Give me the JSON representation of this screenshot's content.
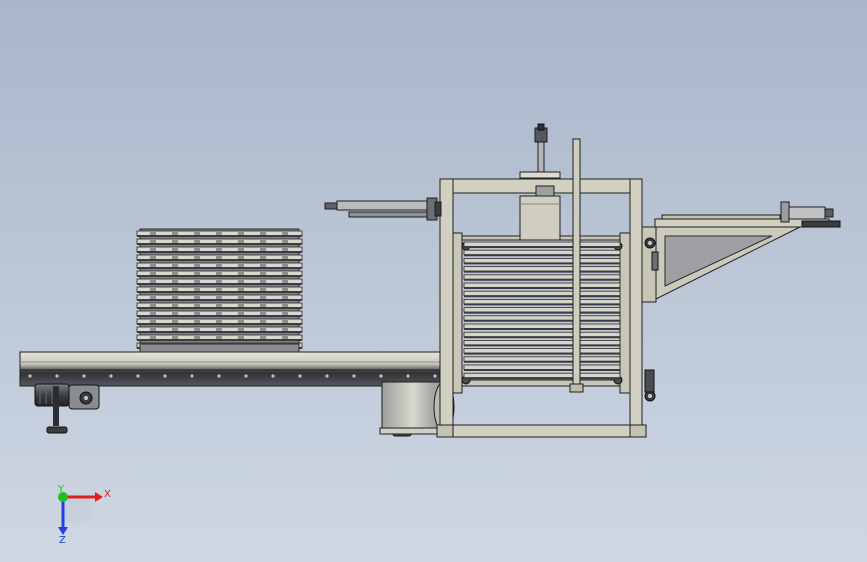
{
  "viewport": {
    "background_top": "#a9b6c9",
    "background_bottom": "#cfd7e3"
  },
  "model": {
    "frame_color": "#d2d1c1",
    "dark_color": "#3a3c40",
    "steel_color": "#b9bbbd",
    "outline_color": "#1e1e20"
  },
  "triad": {
    "x_label": "X",
    "y_label": "Y",
    "z_label": "Z",
    "x_color": "#e02020",
    "y_color": "#20c020",
    "z_color": "#2040e0"
  }
}
